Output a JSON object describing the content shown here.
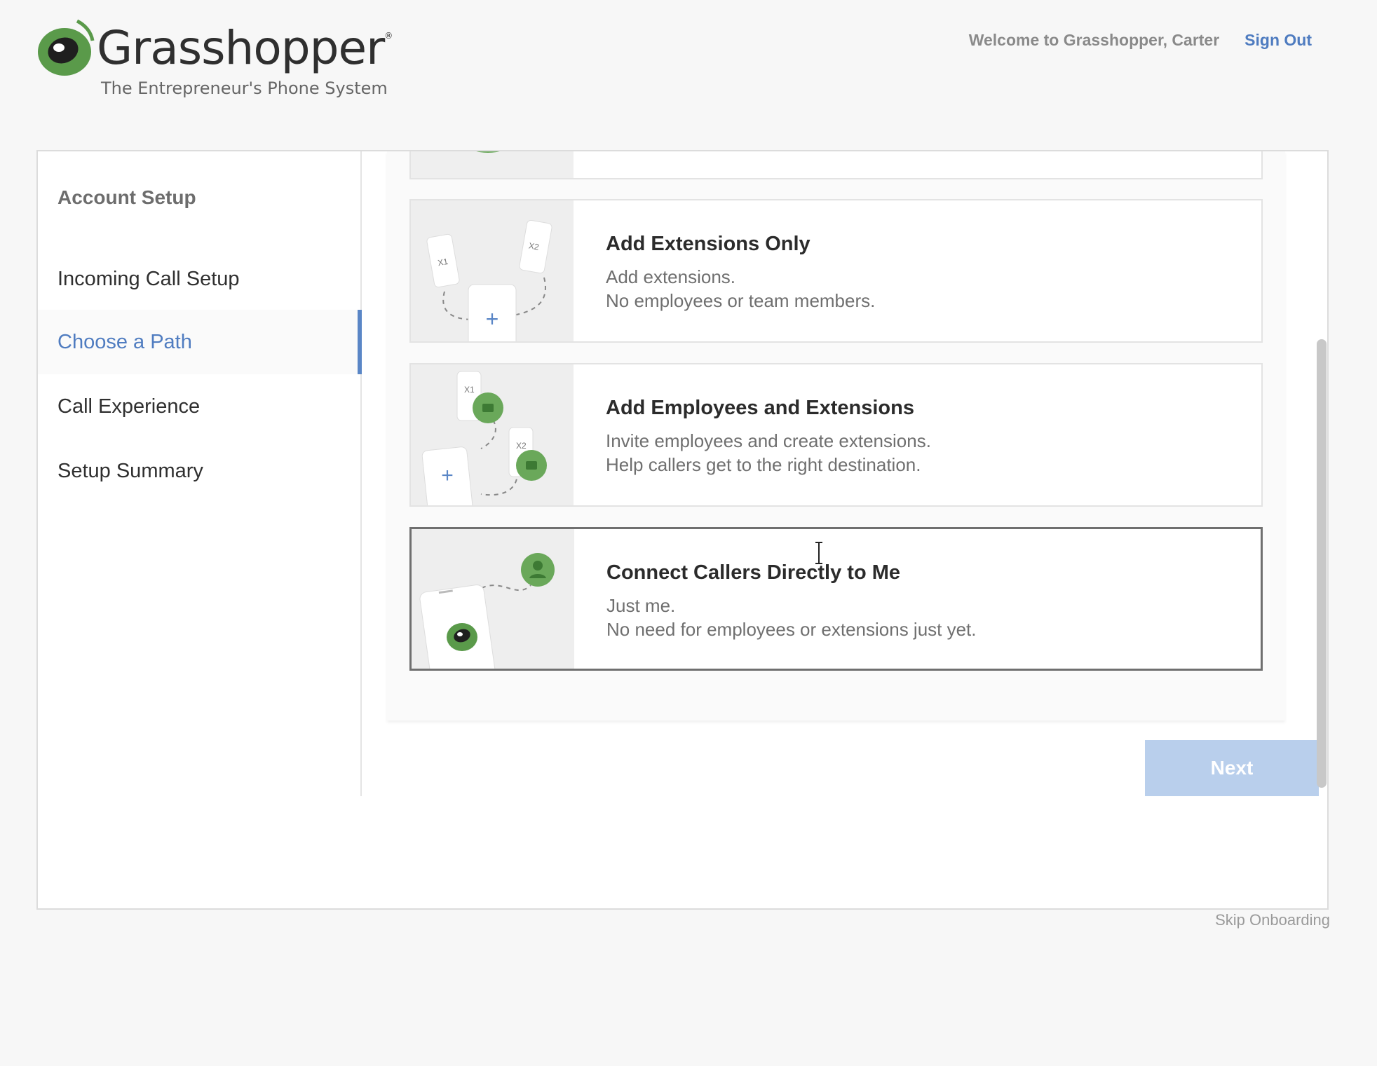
{
  "brand": {
    "name": "Grasshopper",
    "tagline": "The Entrepreneur's Phone System",
    "accent_color": "#4f7cc0",
    "logo_green": "#5a9a4a"
  },
  "header": {
    "welcome_text": "Welcome to Grasshopper, Carter",
    "signout_label": "Sign Out"
  },
  "sidebar": {
    "heading": "Account Setup",
    "items": [
      {
        "label": "Incoming Call Setup",
        "active": false
      },
      {
        "label": "Choose a Path",
        "active": true
      },
      {
        "label": "Call Experience",
        "active": false
      },
      {
        "label": "Setup Summary",
        "active": false
      }
    ]
  },
  "options": [
    {
      "title": "Add Extensions Only",
      "line1": "Add extensions.",
      "line2": "No employees or team members.",
      "icon": "phones-extensions-illustration",
      "selected": false
    },
    {
      "title": "Add Employees and Extensions",
      "line1": "Invite employees and create extensions.",
      "line2": "Help callers get to the right destination.",
      "icon": "employees-extensions-illustration",
      "selected": false
    },
    {
      "title": "Connect Callers Directly to Me",
      "line1": "Just me.",
      "line2": "No need for employees or extensions just yet.",
      "icon": "direct-to-me-illustration",
      "selected": true
    }
  ],
  "thumb_labels": {
    "x1": "X1",
    "x2": "X2"
  },
  "next_label": "Next",
  "skip_label": "Skip Onboarding"
}
